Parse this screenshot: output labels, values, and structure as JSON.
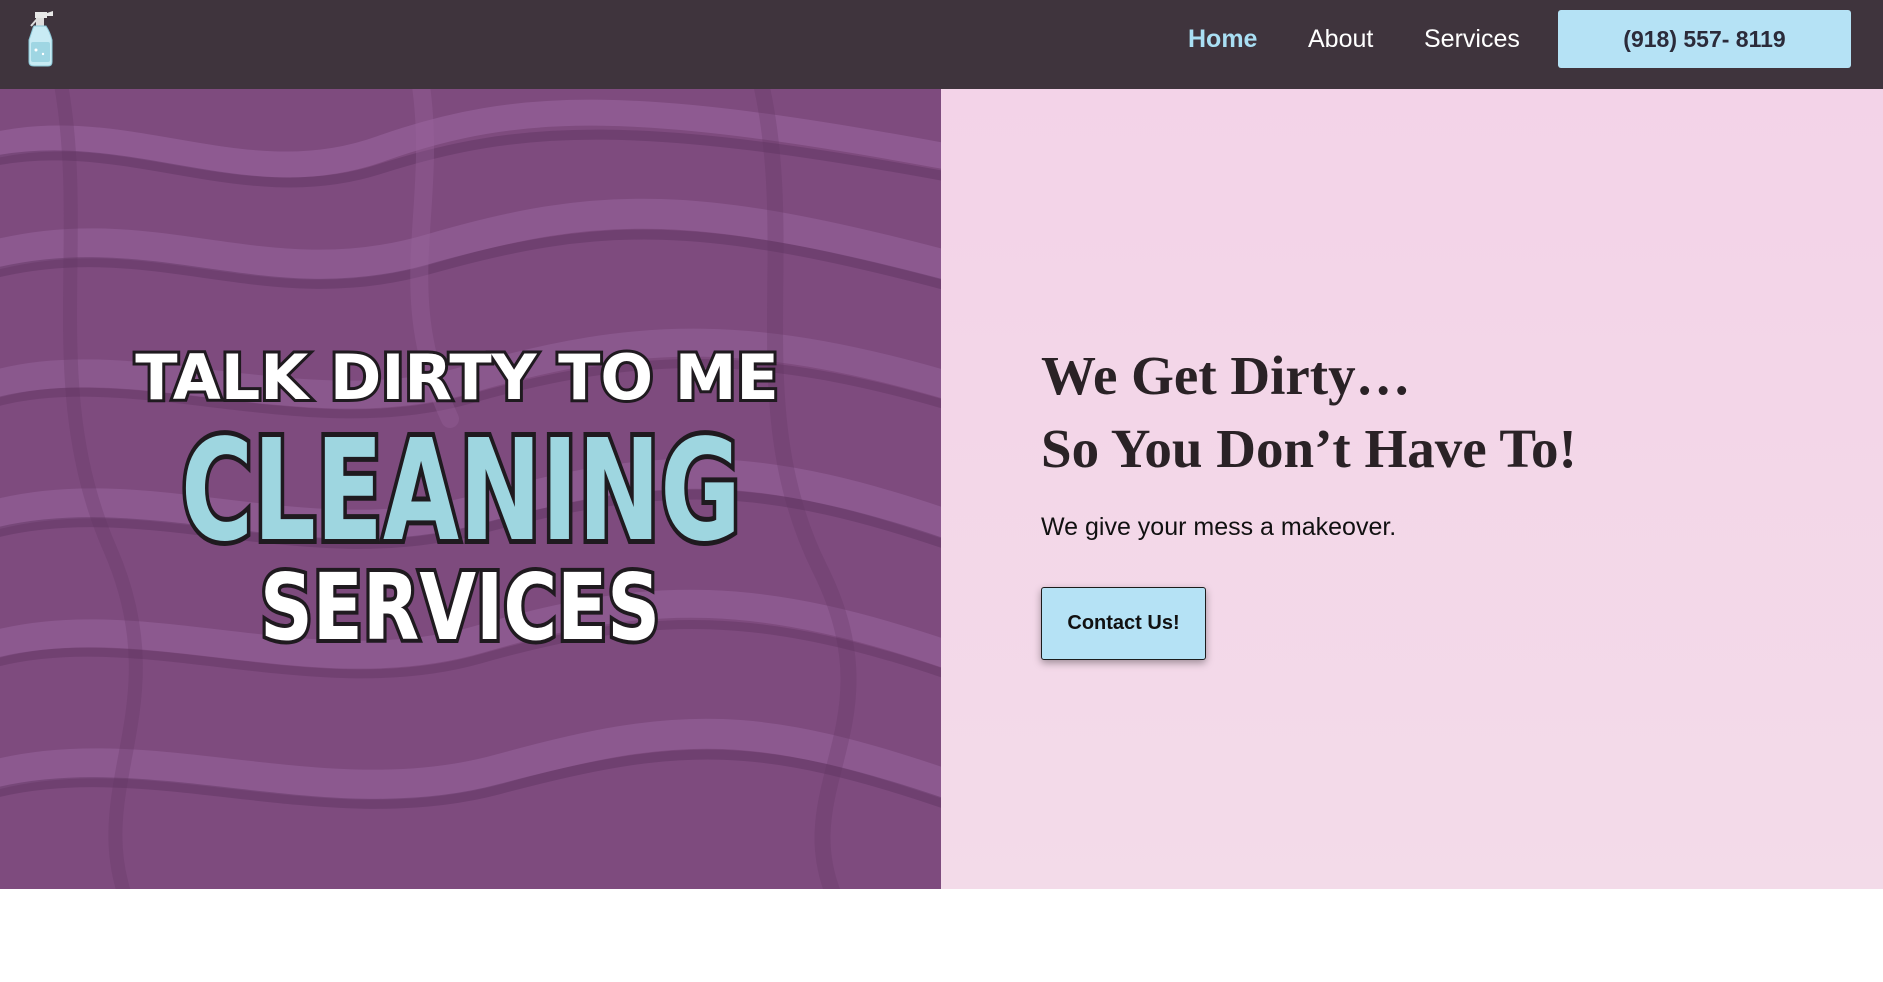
{
  "header": {
    "nav": [
      {
        "label": "Home",
        "active": true
      },
      {
        "label": "About"
      },
      {
        "label": "Services"
      }
    ],
    "phone_button_label": "(918) 557- 8119",
    "logo_icon": "spray-bottle-icon"
  },
  "hero": {
    "logo_lines": [
      "TALK DIRTY TO ME",
      "CLEANING",
      "SERVICES"
    ],
    "headline_line1": "We Get Dirty…",
    "headline_line2": "So You Don’t Have To!",
    "subtext": "We give your mess a makeover.",
    "cta_label": "Contact Us!"
  },
  "colors": {
    "header_bg": "#3f343d",
    "accent_blue": "#b5e2f5",
    "nav_active": "#a9dff4",
    "hero_right_bg": "#f3d3e8",
    "fabric_purple": "#7e4b7e"
  }
}
